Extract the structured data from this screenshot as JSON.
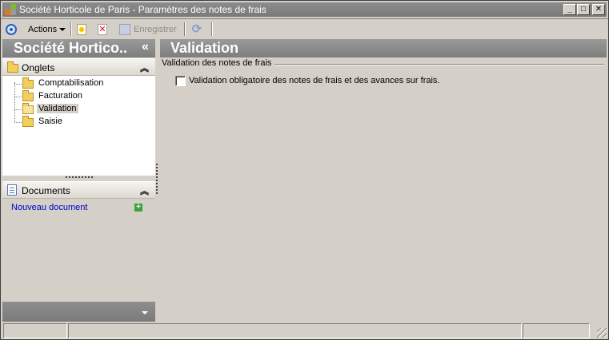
{
  "window": {
    "title": "Société Horticole de Paris -  Paramètres des notes de frais"
  },
  "toolbar": {
    "actions_label": "Actions",
    "save_label": "Enregistrer"
  },
  "left_panel": {
    "title": "Société Hortico..",
    "collapse_glyph": "«",
    "tabs_section": {
      "label": "Onglets",
      "items": [
        {
          "label": "Comptabilisation"
        },
        {
          "label": "Facturation"
        },
        {
          "label": "Validation",
          "selected": true
        },
        {
          "label": "Saisie"
        }
      ]
    },
    "documents_section": {
      "label": "Documents",
      "new_document": "Nouveau document"
    }
  },
  "main": {
    "title": "Validation",
    "group_title": "Validation des notes de frais",
    "checkbox": {
      "label": "Validation obligatoire des notes de frais et des avances sur frais.",
      "checked": false
    }
  },
  "colors": {
    "header_gray": "#8c8c8c",
    "link_blue": "#0000cc",
    "window_bg": "#d4d0c8"
  }
}
